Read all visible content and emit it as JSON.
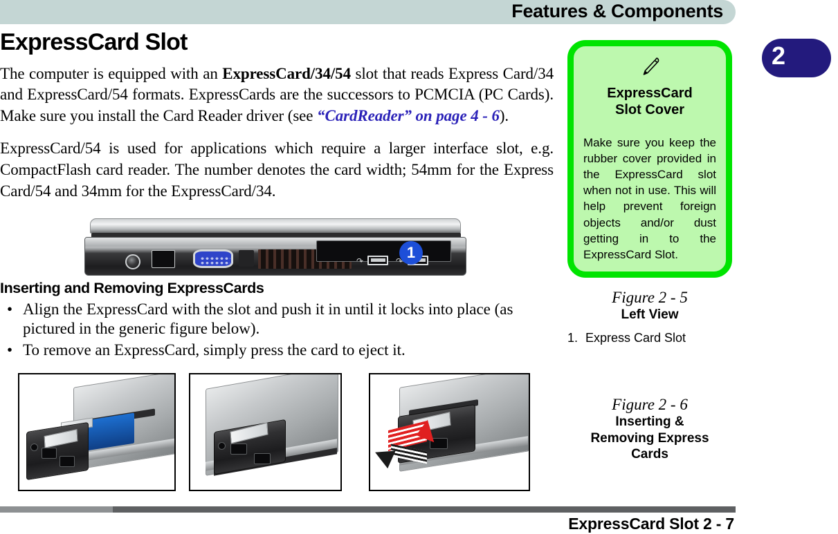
{
  "header": {
    "title": "Features & Components",
    "bar_color": "#c4d6d4"
  },
  "chapter_tab": {
    "number": "2",
    "color": "#231a7d"
  },
  "main": {
    "heading": "ExpressCard Slot",
    "paragraph1": {
      "part1": "The computer is equipped with an ",
      "bold1": "ExpressCard/34/54",
      "part2": " slot that reads Express Card/34 and ExpressCard/54 formats. ExpressCards are the successors to PCMCIA (PC Cards). Make sure you install the Card Reader driver (see ",
      "link": "“CardReader” on page 4 - 6",
      "part3": ")."
    },
    "paragraph2": "ExpressCard/54 is used for applications which require a larger interface slot, e.g. CompactFlash card reader. The number denotes the card width; 54mm for the Express Card/54 and 34mm for the ExpressCard/34.",
    "subheading": "Inserting and Removing ExpressCards",
    "bullets": [
      "Align the ExpressCard with the slot and push it in until it locks into place (as pictured in the generic figure below).",
      "To remove an ExpressCard, simply press the card to eject it."
    ],
    "bullet_glyph": "•"
  },
  "laptop_figure": {
    "callout_number": "1",
    "callout_color": "#1d4fd8",
    "usb_glyph": "⚡",
    "alt": "Left side view of notebook showing power jack, LAN port, VGA port, vents, ExpressCard slot and two USB ports"
  },
  "photos": [
    {
      "alt": "ExpressCard being aligned and inserted into the notebook slot"
    },
    {
      "alt": "ExpressCard fully inserted and locked into place"
    },
    {
      "alt": "ExpressCard being pressed and ejected from the slot"
    }
  ],
  "sidebar": {
    "note": {
      "icon": "pen-icon",
      "title_line1": "ExpressCard",
      "title_line2": "Slot Cover",
      "body": "Make sure you keep the rubber cover provided in the ExpressCard slot when not in use. This will help prevent foreign objects and/or dust getting in to the ExpressCard Slot.",
      "border_color": "#00e400",
      "fill_color": "#bdf8ae"
    },
    "figure5": {
      "number": "Figure 2 - 5",
      "title": "Left View",
      "items": [
        {
          "num": "1.",
          "label": "Express Card Slot"
        }
      ]
    },
    "figure6": {
      "number": "Figure 2 - 6",
      "title_line1": "Inserting &",
      "title_line2": "Removing Express",
      "title_line3": "Cards"
    }
  },
  "footer": {
    "text": "ExpressCard Slot  2  -  7",
    "rule_color": "#5e6062"
  }
}
